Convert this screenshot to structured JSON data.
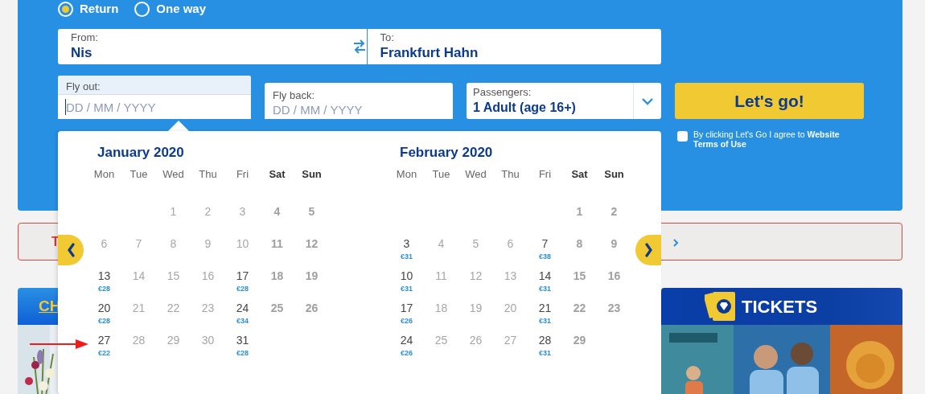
{
  "trip_type": [
    {
      "label": "Return",
      "selected": true
    },
    {
      "label": "One way",
      "selected": false
    }
  ],
  "route": {
    "from": {
      "label": "From:",
      "value": "Nis"
    },
    "to": {
      "label": "To:",
      "value": "Frankfurt Hahn"
    }
  },
  "fly_out": {
    "label": "Fly out:",
    "placeholder": "DD / MM / YYYY",
    "focused": true
  },
  "fly_back": {
    "label": "Fly back:",
    "placeholder": "DD / MM / YYYY",
    "focused": false
  },
  "passengers": {
    "label": "Passengers:",
    "value": "1 Adult (age 16+)"
  },
  "submit": {
    "label": "Let's go!"
  },
  "terms": {
    "checked": false,
    "text": "By clicking Let's Go I agree to **Website Terms of Use**"
  },
  "notice": {
    "text": "T"
  },
  "calendar": {
    "months": [
      {
        "title": "January 2020",
        "weekdays": [
          "Mon",
          "Tue",
          "Wed",
          "Thu",
          "Fri",
          "Sat",
          "Sun"
        ],
        "weeks": [
          [
            {
              "kind": "empty"
            },
            {
              "kind": "empty"
            },
            {
              "kind": "day",
              "day": "1",
              "available": false
            },
            {
              "kind": "day",
              "day": "2",
              "available": false
            },
            {
              "kind": "day",
              "day": "3",
              "available": false
            },
            {
              "kind": "day",
              "day": "4",
              "available": false
            },
            {
              "kind": "day",
              "day": "5",
              "available": false
            }
          ],
          [
            {
              "kind": "day",
              "day": "6",
              "available": false
            },
            {
              "kind": "day",
              "day": "7",
              "available": false
            },
            {
              "kind": "day",
              "day": "8",
              "available": false
            },
            {
              "kind": "day",
              "day": "9",
              "available": false
            },
            {
              "kind": "day",
              "day": "10",
              "available": false
            },
            {
              "kind": "day",
              "day": "11",
              "available": false
            },
            {
              "kind": "day",
              "day": "12",
              "available": false
            }
          ],
          [
            {
              "kind": "day",
              "day": "13",
              "available": true,
              "price": "€28"
            },
            {
              "kind": "day",
              "day": "14",
              "available": false
            },
            {
              "kind": "day",
              "day": "15",
              "available": false
            },
            {
              "kind": "day",
              "day": "16",
              "available": false
            },
            {
              "kind": "day",
              "day": "17",
              "available": true,
              "price": "€28"
            },
            {
              "kind": "day",
              "day": "18",
              "available": false
            },
            {
              "kind": "day",
              "day": "19",
              "available": false
            }
          ],
          [
            {
              "kind": "day",
              "day": "20",
              "available": true,
              "price": "€28"
            },
            {
              "kind": "day",
              "day": "21",
              "available": false
            },
            {
              "kind": "day",
              "day": "22",
              "available": false
            },
            {
              "kind": "day",
              "day": "23",
              "available": false
            },
            {
              "kind": "day",
              "day": "24",
              "available": true,
              "price": "€34"
            },
            {
              "kind": "day",
              "day": "25",
              "available": false
            },
            {
              "kind": "day",
              "day": "26",
              "available": false
            }
          ],
          [
            {
              "kind": "day",
              "day": "27",
              "available": true,
              "price": "€22"
            },
            {
              "kind": "day",
              "day": "28",
              "available": false
            },
            {
              "kind": "day",
              "day": "29",
              "available": false
            },
            {
              "kind": "day",
              "day": "30",
              "available": false
            },
            {
              "kind": "day",
              "day": "31",
              "available": true,
              "price": "€28"
            },
            {
              "kind": "empty"
            },
            {
              "kind": "empty"
            }
          ]
        ]
      },
      {
        "title": "February 2020",
        "weekdays": [
          "Mon",
          "Tue",
          "Wed",
          "Thu",
          "Fri",
          "Sat",
          "Sun"
        ],
        "weeks": [
          [
            {
              "kind": "empty"
            },
            {
              "kind": "empty"
            },
            {
              "kind": "empty"
            },
            {
              "kind": "empty"
            },
            {
              "kind": "empty"
            },
            {
              "kind": "day",
              "day": "1",
              "available": false
            },
            {
              "kind": "day",
              "day": "2",
              "available": false
            }
          ],
          [
            {
              "kind": "day",
              "day": "3",
              "available": true,
              "price": "€31"
            },
            {
              "kind": "day",
              "day": "4",
              "available": false
            },
            {
              "kind": "day",
              "day": "5",
              "available": false
            },
            {
              "kind": "day",
              "day": "6",
              "available": false
            },
            {
              "kind": "day",
              "day": "7",
              "available": true,
              "price": "€38"
            },
            {
              "kind": "day",
              "day": "8",
              "available": false
            },
            {
              "kind": "day",
              "day": "9",
              "available": false
            }
          ],
          [
            {
              "kind": "day",
              "day": "10",
              "available": true,
              "price": "€31"
            },
            {
              "kind": "day",
              "day": "11",
              "available": false
            },
            {
              "kind": "day",
              "day": "12",
              "available": false
            },
            {
              "kind": "day",
              "day": "13",
              "available": false
            },
            {
              "kind": "day",
              "day": "14",
              "available": true,
              "price": "€31"
            },
            {
              "kind": "day",
              "day": "15",
              "available": false
            },
            {
              "kind": "day",
              "day": "16",
              "available": false
            }
          ],
          [
            {
              "kind": "day",
              "day": "17",
              "available": true,
              "price": "€26"
            },
            {
              "kind": "day",
              "day": "18",
              "available": false
            },
            {
              "kind": "day",
              "day": "19",
              "available": false
            },
            {
              "kind": "day",
              "day": "20",
              "available": false
            },
            {
              "kind": "day",
              "day": "21",
              "available": true,
              "price": "€31"
            },
            {
              "kind": "day",
              "day": "22",
              "available": false
            },
            {
              "kind": "day",
              "day": "23",
              "available": false
            }
          ],
          [
            {
              "kind": "day",
              "day": "24",
              "available": true,
              "price": "€26"
            },
            {
              "kind": "day",
              "day": "25",
              "available": false
            },
            {
              "kind": "day",
              "day": "26",
              "available": false
            },
            {
              "kind": "day",
              "day": "27",
              "available": false
            },
            {
              "kind": "day",
              "day": "28",
              "available": true,
              "price": "€31"
            },
            {
              "kind": "day",
              "day": "29",
              "available": false
            },
            {
              "kind": "empty"
            }
          ]
        ]
      }
    ]
  },
  "promo_cards": [
    {
      "kind": "flowers",
      "title": "CH"
    },
    {
      "kind": "tickets",
      "title": "TICKETS"
    }
  ]
}
